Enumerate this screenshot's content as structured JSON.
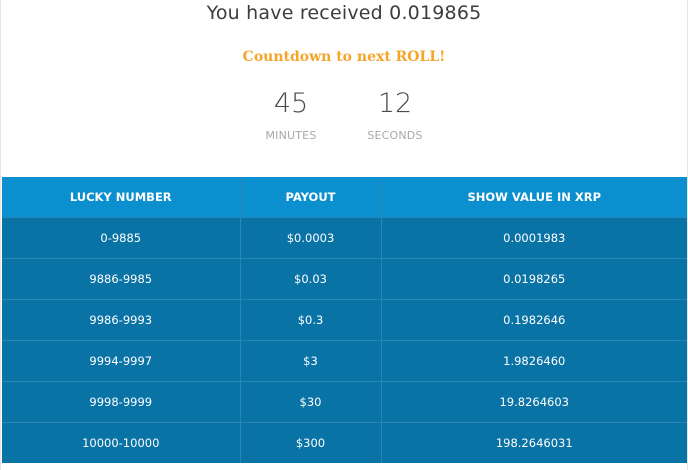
{
  "received": {
    "text": "You have received 0.019865"
  },
  "countdown": {
    "title": "Countdown to next ROLL!",
    "minutes": {
      "value": "45",
      "unit": "MINUTES"
    },
    "seconds": {
      "value": "12",
      "unit": "SECONDS"
    }
  },
  "payout_table": {
    "headers": [
      "LUCKY NUMBER",
      "PAYOUT",
      "SHOW VALUE IN XRP"
    ],
    "rows": [
      [
        "0-9885",
        "$0.0003",
        "0.0001983"
      ],
      [
        "9886-9985",
        "$0.03",
        "0.0198265"
      ],
      [
        "9986-9993",
        "$0.3",
        "0.1982646"
      ],
      [
        "9994-9997",
        "$3",
        "1.9826460"
      ],
      [
        "9998-9999",
        "$30",
        "19.8264603"
      ],
      [
        "10000-10000",
        "$300",
        "198.2646031"
      ]
    ]
  },
  "colors": {
    "header_bg": "#0b8fcf",
    "row_bg": "#0a73a6",
    "countdown_accent": "#f4a52a"
  }
}
